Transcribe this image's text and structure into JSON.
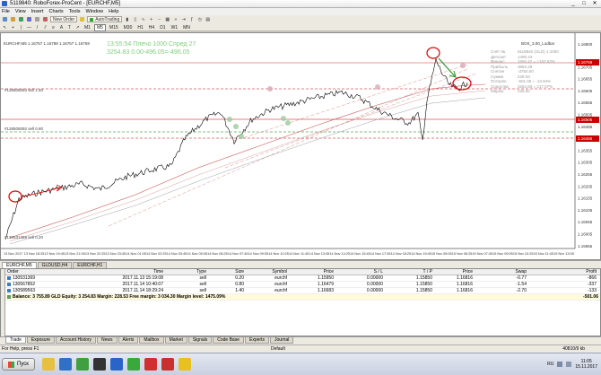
{
  "window": {
    "title": "5119840: RoboForex-ProCent - [EURCHF,M5]",
    "minimize": "_",
    "maximize": "□",
    "close": "✕"
  },
  "menu": [
    "File",
    "View",
    "Insert",
    "Charts",
    "Tools",
    "Window",
    "Help"
  ],
  "toolbar": {
    "new_order": "New Order",
    "auto_trading": "AutoTrading",
    "timeframes": [
      "M1",
      "M5",
      "M15",
      "M30",
      "H1",
      "H4",
      "D1",
      "W1",
      "MN"
    ],
    "active_timeframe": "M5"
  },
  "chart": {
    "header": "EURCHF,M5  1.16757 1.16798 1.16757 1.16759",
    "overlay_line1": "13:55:54 Плечо 1000 Спред 27",
    "overlay_line2": "3254.83  0.00-496.05=-496.05",
    "top_right_label": "BOS_3.00_Lodbar",
    "order_labels": [
      "#128505093 sell 1.40",
      "#128505092 sell 0.80",
      "#130531369 sell 0.20"
    ],
    "info_panel": [
      [
        "Счёт №",
        "5119840 (GLD) 1:1000"
      ],
      [
        "Депозит",
        "1495.44"
      ],
      [
        "Финанс.",
        "1550.42 = +163.63%"
      ],
      [
        "Прибыль",
        "3863.28"
      ],
      [
        "Снятие",
        "-3750.00"
      ],
      [
        "Сумма",
        "228.53"
      ],
      [
        "Потерян",
        "-501.06 = -13.94%"
      ],
      [
        "Средства",
        "3254.83 = 217.07%"
      ],
      [
        "Маржа",
        "228.50"
      ]
    ],
    "price_labels": [
      "1.16800",
      "1.16759",
      "1.16705",
      "1.16655",
      "1.16605",
      "1.16555",
      "1.16505",
      "1.16455",
      "1.16405",
      "1.16355",
      "1.16305",
      "1.16255",
      "1.16205",
      "1.16155",
      "1.16105",
      "1.16055",
      "1.16005",
      "1.15955"
    ],
    "time_labels": [
      "13 Nov 2017",
      "13 Nov 18:25",
      "13 Nov 19:45",
      "13 Nov 21:05",
      "13 Nov 22:25",
      "13 Nov 23:45",
      "14 Nov 01:05",
      "14 Nov 02:25",
      "14 Nov 03:45",
      "14 Nov 05:05",
      "14 Nov 06:25",
      "14 Nov 07:45",
      "14 Nov 09:05",
      "14 Nov 10:25",
      "14 Nov 11:45",
      "14 Nov 13:05",
      "14 Nov 14:25",
      "14 Nov 15:45",
      "14 Nov 17:05",
      "14 Nov 18:25",
      "14 Nov 19:45",
      "15 Nov 05:05",
      "15 Nov 06:25",
      "15 Nov 07:45",
      "15 Nov 09:05",
      "15 Nov 10:25",
      "15 Nov 11:45",
      "15 Nov 13:05"
    ],
    "colors": {
      "up": "#000000",
      "sell_line": "#cc0000",
      "tp_line": "#007a00",
      "ma": "#c85050",
      "annotation": "#e00000",
      "arrow": "#2a9a2a"
    }
  },
  "chart_tabs": [
    {
      "label": "EURCHF,M5",
      "active": true
    },
    {
      "label": "GLDUSD,H4",
      "active": false
    },
    {
      "label": "EURCHF,H1",
      "active": false
    }
  ],
  "terminal": {
    "columns": [
      "Order",
      "Time",
      "Type",
      "Size",
      "Symbol",
      "Price",
      "S / L",
      "T / P",
      "Price",
      "Swap",
      "Profit"
    ],
    "rows": [
      [
        "130531369",
        "2017.11.13 15:19:08",
        "sell",
        "0.20",
        "eurchf",
        "1.15950",
        "0.00000",
        "1.15850",
        "1.16816",
        "-0.77",
        "-866"
      ],
      [
        "130567852",
        "2017.11.14 10:40:07",
        "sell",
        "0.80",
        "eurchf",
        "1.16479",
        "0.00000",
        "1.15850",
        "1.16816",
        "-1.54",
        "-337"
      ],
      [
        "130589563",
        "2017.11.14 18:29:24",
        "sell",
        "1.40",
        "eurchf",
        "1.16683",
        "0.00000",
        "1.15850",
        "1.16816",
        "-2.70",
        "-133"
      ]
    ],
    "balance": "Balance: 3 755.89 GLD  Equity: 3 254.83  Margin: 228.53  Free margin: 3 034.30  Margin level: 1475.09%",
    "total_profit": "-501.06"
  },
  "terminal_tabs": [
    {
      "label": "Trade",
      "active": true
    },
    {
      "label": "Exposure",
      "active": false
    },
    {
      "label": "Account History",
      "active": false
    },
    {
      "label": "News",
      "active": false
    },
    {
      "label": "Alerts",
      "active": false
    },
    {
      "label": "Mailbox",
      "active": false
    },
    {
      "label": "Market",
      "active": false
    },
    {
      "label": "Signals",
      "active": false
    },
    {
      "label": "Code Base",
      "active": false
    },
    {
      "label": "Experts",
      "active": false
    },
    {
      "label": "Journal",
      "active": false
    }
  ],
  "status": {
    "help": "For Help, press F1",
    "profile": "Default",
    "traffic": "40810/9 kb"
  },
  "taskbar": {
    "start": "Пуск",
    "lang": "RU",
    "time": "11:05",
    "date": "15.11.2017"
  }
}
